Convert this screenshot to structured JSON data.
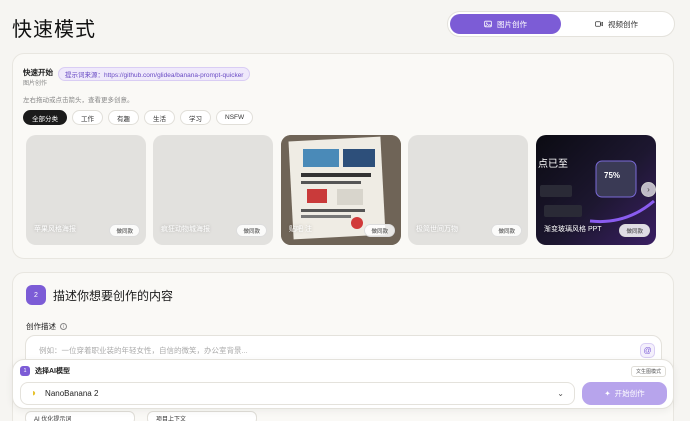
{
  "header": {
    "title": "快速模式",
    "modes": [
      {
        "label": "图片创作",
        "icon": "image-icon",
        "active": true
      },
      {
        "label": "视频创作",
        "icon": "video-icon",
        "active": false
      }
    ]
  },
  "quick_start": {
    "title": "快速开始",
    "subtitle": "图片创作",
    "source_label": "提示词来源：https://github.com/glidea/banana-prompt-quicker",
    "hint": "左右拖动或点击箭头，查看更多创意。",
    "categories": [
      {
        "label": "全部分类",
        "active": true
      },
      {
        "label": "工作",
        "active": false
      },
      {
        "label": "有趣",
        "active": false
      },
      {
        "label": "生活",
        "active": false
      },
      {
        "label": "学习",
        "active": false
      },
      {
        "label": "NSFW",
        "active": false
      }
    ],
    "templates": [
      {
        "caption": "苹果风格海报",
        "button": "做同款"
      },
      {
        "caption": "疯狂动物城海报",
        "button": "做同款"
      },
      {
        "caption": "贴吧 注",
        "button": "做同款"
      },
      {
        "caption": "极简世间万物",
        "button": "做同款"
      },
      {
        "caption": "渐变玻璃风格 PPT",
        "overlay": "点已至",
        "badge": "75%",
        "button": "做同款"
      }
    ],
    "scroll_next_icon": "chevron-right-icon"
  },
  "describe": {
    "step": "2",
    "title": "描述你想要创作的内容",
    "field_label": "创作描述",
    "placeholder": "例如：一位穿着职业装的年轻女性，自信的微笑，办公室背景...",
    "mode_tag": "文生图模式"
  },
  "model": {
    "step": "1",
    "label": "选择AI模型",
    "selected": "NanoBanana 2",
    "start_label": "开始创作"
  },
  "peek": {
    "items": [
      "AI 优化提示词",
      "项目上下文"
    ]
  },
  "colors": {
    "accent": "#7c5cd6",
    "accent_light": "#b7a4ec",
    "background": "#f6f5f2"
  }
}
